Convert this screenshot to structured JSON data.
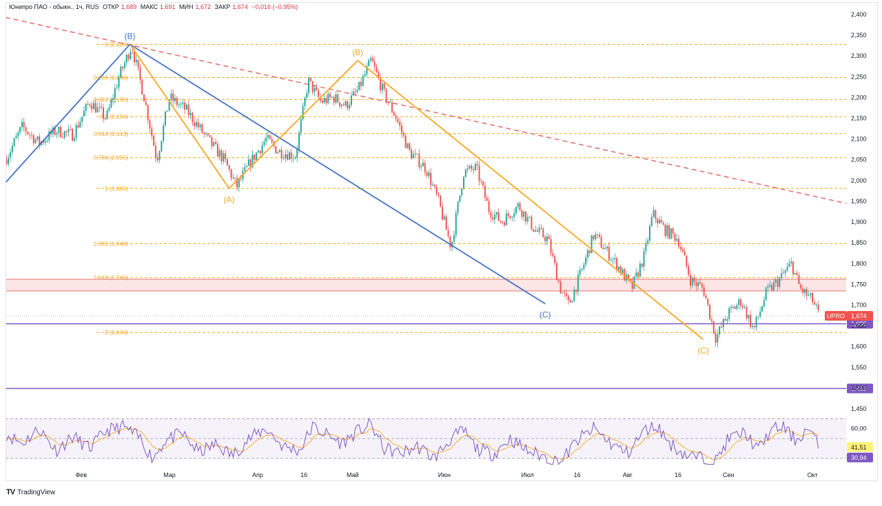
{
  "header": {
    "instrument": "Юнипро ПАО - обыкн., 1ч, RUS",
    "open_label": "ОТКР",
    "open_value": "1,689",
    "high_label": "МАКС",
    "high_value": "1,691",
    "low_label": "МИН",
    "low_value": "1,672",
    "close_label": "ЗАКР",
    "close_value": "1,674",
    "change": "−0,016 (−0,95%)"
  },
  "branding": {
    "logo_text": "TradingView",
    "logo_mark": "TV"
  },
  "colors": {
    "up": "#26a69a",
    "down": "#ef5350",
    "price_line": "#ef5350",
    "blue_wave": "#4472c4",
    "orange_wave": "#f5a623",
    "fib": "#f5a623",
    "support": "#7e57c2",
    "resistance_band": "#f6b4b4",
    "rsi": "#7e57c2"
  },
  "chart_data": {
    "type": "candlestick",
    "title": "Юнипро ПАО - обыкн., 1ч, RUS",
    "price_axis": {
      "ticks": [
        "2,400",
        "2,350",
        "2,300",
        "2,250",
        "2,200",
        "2,150",
        "2,100",
        "2,050",
        "2,000",
        "1,950",
        "1,900",
        "1,850",
        "1,800",
        "1,750",
        "1,700",
        "1,650",
        "1,600",
        "1,550",
        "1,500",
        "1,450"
      ],
      "range": [
        1.45,
        2.4
      ]
    },
    "time_axis": {
      "ticks": [
        {
          "label": "Фев",
          "t": 0.09
        },
        {
          "label": "Мар",
          "t": 0.195
        },
        {
          "label": "Апр",
          "t": 0.3
        },
        {
          "label": "16",
          "t": 0.355
        },
        {
          "label": "Май",
          "t": 0.413
        },
        {
          "label": "Июн",
          "t": 0.522
        },
        {
          "label": "Июл",
          "t": 0.621
        },
        {
          "label": "16",
          "t": 0.68
        },
        {
          "label": "Авг",
          "t": 0.74
        },
        {
          "label": "16",
          "t": 0.8
        },
        {
          "label": "Сен",
          "t": 0.86
        },
        {
          "label": "Окт",
          "t": 0.96
        }
      ]
    },
    "price_path": [
      [
        0.0,
        2.05
      ],
      [
        0.02,
        2.13
      ],
      [
        0.04,
        2.09
      ],
      [
        0.06,
        2.12
      ],
      [
        0.08,
        2.11
      ],
      [
        0.1,
        2.19
      ],
      [
        0.12,
        2.15
      ],
      [
        0.135,
        2.25
      ],
      [
        0.15,
        2.325
      ],
      [
        0.165,
        2.2
      ],
      [
        0.18,
        2.05
      ],
      [
        0.195,
        2.2
      ],
      [
        0.215,
        2.17
      ],
      [
        0.24,
        2.1
      ],
      [
        0.26,
        2.05
      ],
      [
        0.275,
        1.985
      ],
      [
        0.29,
        2.04
      ],
      [
        0.31,
        2.1
      ],
      [
        0.325,
        2.07
      ],
      [
        0.345,
        2.06
      ],
      [
        0.36,
        2.24
      ],
      [
        0.375,
        2.19
      ],
      [
        0.39,
        2.2
      ],
      [
        0.405,
        2.18
      ],
      [
        0.42,
        2.22
      ],
      [
        0.435,
        2.29
      ],
      [
        0.45,
        2.21
      ],
      [
        0.465,
        2.15
      ],
      [
        0.48,
        2.07
      ],
      [
        0.5,
        2.03
      ],
      [
        0.515,
        1.95
      ],
      [
        0.53,
        1.84
      ],
      [
        0.545,
        2.02
      ],
      [
        0.56,
        2.03
      ],
      [
        0.575,
        1.93
      ],
      [
        0.59,
        1.9
      ],
      [
        0.61,
        1.94
      ],
      [
        0.63,
        1.88
      ],
      [
        0.645,
        1.86
      ],
      [
        0.66,
        1.74
      ],
      [
        0.67,
        1.7
      ],
      [
        0.685,
        1.78
      ],
      [
        0.7,
        1.87
      ],
      [
        0.715,
        1.83
      ],
      [
        0.73,
        1.79
      ],
      [
        0.745,
        1.74
      ],
      [
        0.76,
        1.82
      ],
      [
        0.77,
        1.92
      ],
      [
        0.785,
        1.88
      ],
      [
        0.8,
        1.86
      ],
      [
        0.815,
        1.76
      ],
      [
        0.83,
        1.74
      ],
      [
        0.845,
        1.62
      ],
      [
        0.86,
        1.68
      ],
      [
        0.875,
        1.71
      ],
      [
        0.89,
        1.64
      ],
      [
        0.905,
        1.73
      ],
      [
        0.92,
        1.76
      ],
      [
        0.935,
        1.8
      ],
      [
        0.945,
        1.74
      ],
      [
        0.96,
        1.71
      ],
      [
        0.968,
        1.674
      ]
    ],
    "rsi_path": [
      [
        0.0,
        55
      ],
      [
        0.02,
        45
      ],
      [
        0.04,
        60
      ],
      [
        0.06,
        38
      ],
      [
        0.08,
        52
      ],
      [
        0.1,
        40
      ],
      [
        0.12,
        58
      ],
      [
        0.14,
        62
      ],
      [
        0.16,
        50
      ],
      [
        0.175,
        30
      ],
      [
        0.19,
        48
      ],
      [
        0.21,
        55
      ],
      [
        0.23,
        36
      ],
      [
        0.25,
        44
      ],
      [
        0.27,
        33
      ],
      [
        0.29,
        50
      ],
      [
        0.31,
        60
      ],
      [
        0.33,
        42
      ],
      [
        0.35,
        38
      ],
      [
        0.365,
        62
      ],
      [
        0.38,
        55
      ],
      [
        0.4,
        45
      ],
      [
        0.42,
        58
      ],
      [
        0.435,
        64
      ],
      [
        0.45,
        40
      ],
      [
        0.47,
        35
      ],
      [
        0.49,
        42
      ],
      [
        0.51,
        30
      ],
      [
        0.53,
        50
      ],
      [
        0.545,
        58
      ],
      [
        0.56,
        40
      ],
      [
        0.58,
        34
      ],
      [
        0.6,
        50
      ],
      [
        0.62,
        38
      ],
      [
        0.64,
        32
      ],
      [
        0.66,
        26
      ],
      [
        0.68,
        48
      ],
      [
        0.7,
        60
      ],
      [
        0.72,
        45
      ],
      [
        0.74,
        35
      ],
      [
        0.76,
        58
      ],
      [
        0.775,
        63
      ],
      [
        0.79,
        45
      ],
      [
        0.81,
        33
      ],
      [
        0.83,
        30
      ],
      [
        0.845,
        27
      ],
      [
        0.86,
        50
      ],
      [
        0.88,
        56
      ],
      [
        0.895,
        38
      ],
      [
        0.91,
        58
      ],
      [
        0.925,
        62
      ],
      [
        0.94,
        48
      ],
      [
        0.955,
        60
      ],
      [
        0.968,
        41.5
      ]
    ],
    "fib_levels": [
      {
        "label": "0 (2,328)",
        "value": 2.328
      },
      {
        "label": "0,236 (2,248)",
        "value": 2.248
      },
      {
        "label": "0,382 (2,195)",
        "value": 2.195
      },
      {
        "label": "0,5 (2,154)",
        "value": 2.154
      },
      {
        "label": "0,618 (2,113)",
        "value": 2.113
      },
      {
        "label": "0,786 (2,055)",
        "value": 2.055
      },
      {
        "label": "1 (1,981)",
        "value": 1.981
      },
      {
        "label": "1,382 (1,848)",
        "value": 1.848
      },
      {
        "label": "1,618 (1,766)",
        "value": 1.766
      },
      {
        "label": "2 (1,634)",
        "value": 1.634
      }
    ],
    "support_levels": [
      {
        "label": "1,655",
        "value": 1.655
      },
      {
        "label": "1,499",
        "value": 1.499
      }
    ],
    "resistance_band": [
      1.734,
      1.762
    ],
    "trend_line": {
      "from": [
        0.0,
        2.393
      ],
      "to": [
        1.0,
        1.945
      ],
      "style": "dashed"
    },
    "blue_wave": [
      {
        "t": 0.0,
        "v": 1.995,
        "label": ""
      },
      {
        "t": 0.148,
        "v": 2.328,
        "label": "(B)"
      },
      {
        "t": 0.642,
        "v": 1.703,
        "label": "(C)"
      }
    ],
    "orange_wave": [
      {
        "t": 0.148,
        "v": 2.328,
        "label": ""
      },
      {
        "t": 0.266,
        "v": 1.981,
        "label": "(A)"
      },
      {
        "t": 0.419,
        "v": 2.289,
        "label": "(B)"
      },
      {
        "t": 0.83,
        "v": 1.617,
        "label": "(C)"
      }
    ],
    "last_price": {
      "label": "1,674",
      "value": 1.674,
      "ticker": "UPRO"
    },
    "rsi": {
      "upper": 70,
      "lower": 30,
      "range": [
        23,
        73
      ],
      "ticks": [
        {
          "label": "60,00",
          "value": 60
        }
      ],
      "current": {
        "label": "41,51",
        "value": 41.51
      },
      "signal": {
        "label": "30,94",
        "value": 30.94
      }
    }
  }
}
